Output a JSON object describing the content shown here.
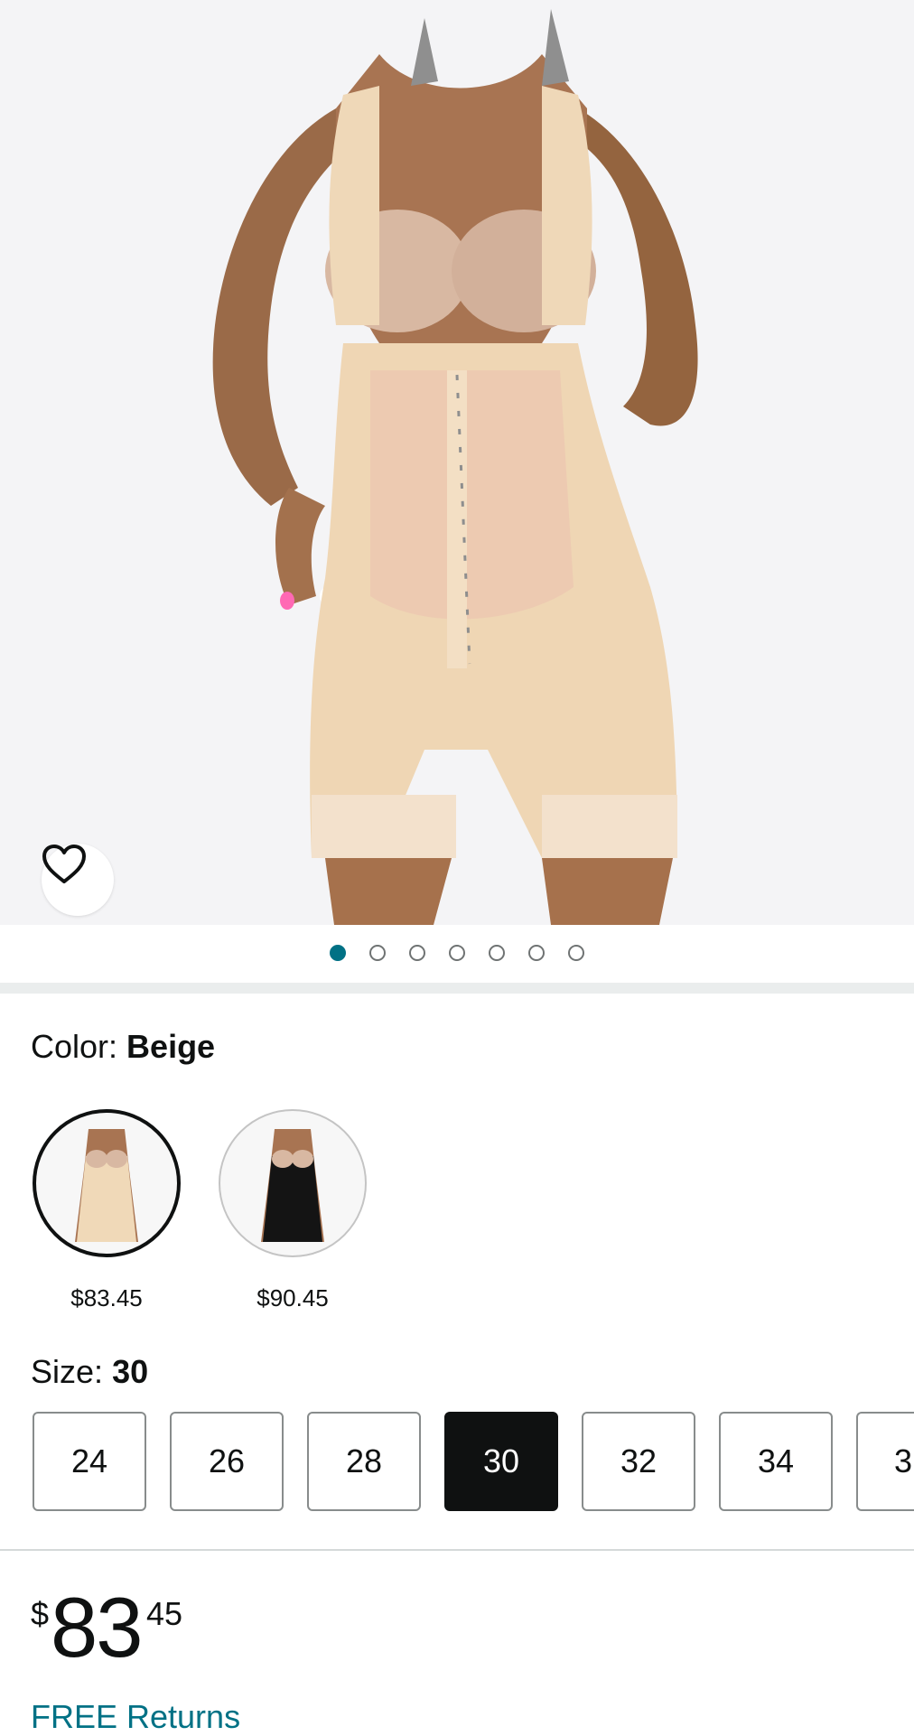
{
  "product_image": {
    "alt": "product-photo"
  },
  "favorite": {
    "icon": "heart-icon"
  },
  "carousel": {
    "count": 7,
    "active_index": 0,
    "accent": "#007185"
  },
  "color": {
    "label": "Color:",
    "selected": "Beige",
    "options": [
      {
        "name": "Beige",
        "price": "$83.45",
        "tone": "#f0d9b8"
      },
      {
        "name": "Black",
        "price": "$90.45",
        "tone": "#141414"
      }
    ]
  },
  "size": {
    "label": "Size:",
    "selected": "30",
    "options": [
      "24",
      "26",
      "28",
      "30",
      "32",
      "34",
      "3"
    ]
  },
  "price": {
    "symbol": "$",
    "whole": "83",
    "fraction": "45"
  },
  "returns": {
    "label": "FREE Returns",
    "color": "#007185"
  }
}
